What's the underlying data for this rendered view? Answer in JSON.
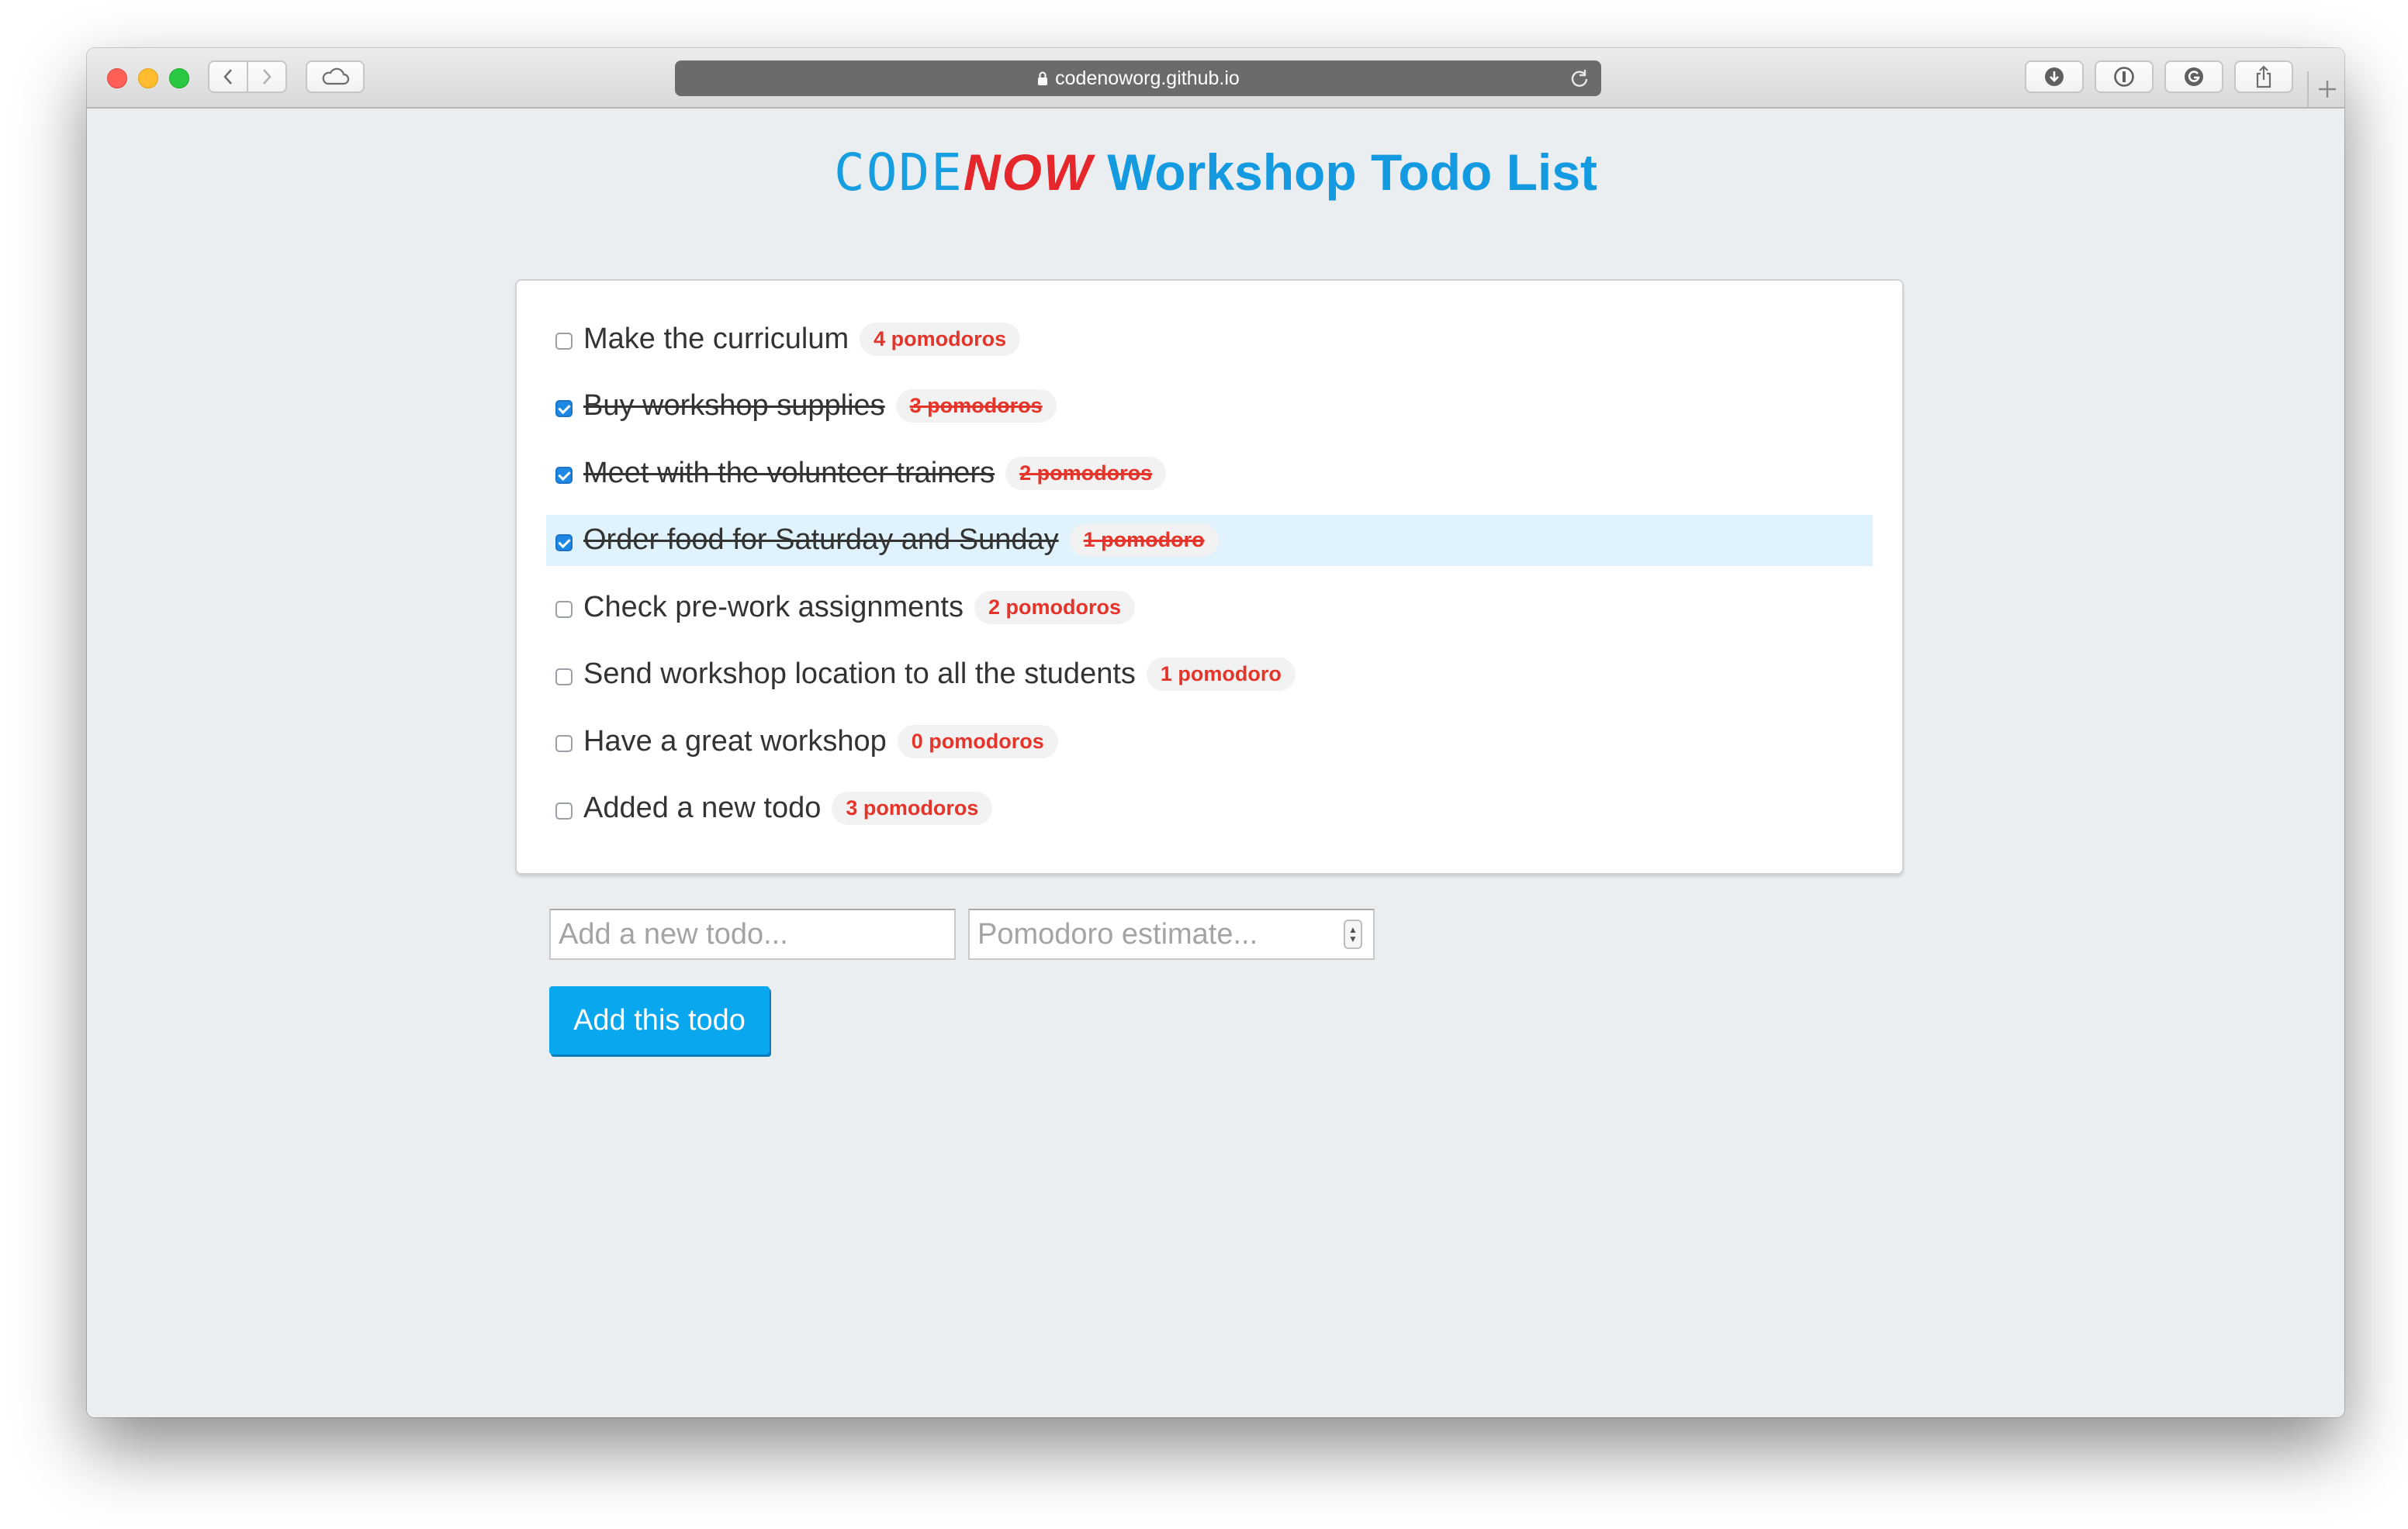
{
  "browser": {
    "url": "codenoworg.github.io"
  },
  "header": {
    "logo_code": "CODE",
    "logo_now": "NOW",
    "title": "Workshop Todo List"
  },
  "todos": [
    {
      "text": "Make the curriculum",
      "estimate": "4 pomodoros",
      "done": false
    },
    {
      "text": "Buy workshop supplies",
      "estimate": "3 pomodoros",
      "done": true
    },
    {
      "text": "Meet with the volunteer trainers",
      "estimate": "2 pomodoros",
      "done": true
    },
    {
      "text": "Order food for Saturday and Sunday",
      "estimate": "1 pomodoro",
      "done": true,
      "highlighted": true
    },
    {
      "text": "Check pre-work assignments",
      "estimate": "2 pomodoros",
      "done": false
    },
    {
      "text": "Send workshop location to all the students",
      "estimate": "1 pomodoro",
      "done": false
    },
    {
      "text": "Have a great workshop",
      "estimate": "0 pomodoros",
      "done": false
    },
    {
      "text": "Added a new todo",
      "estimate": "3 pomodoros",
      "done": false
    }
  ],
  "form": {
    "todo_placeholder": "Add a new todo...",
    "todo_value": "",
    "pomodoro_placeholder": "Pomodoro estimate...",
    "pomodoro_value": "",
    "submit_label": "Add this todo"
  },
  "colors": {
    "accent": "#08a7ee",
    "badge_text": "#e5342a",
    "logo_now": "#e5262b",
    "highlight_row": "#e0f2fb",
    "page_background": "#ebeef1"
  }
}
